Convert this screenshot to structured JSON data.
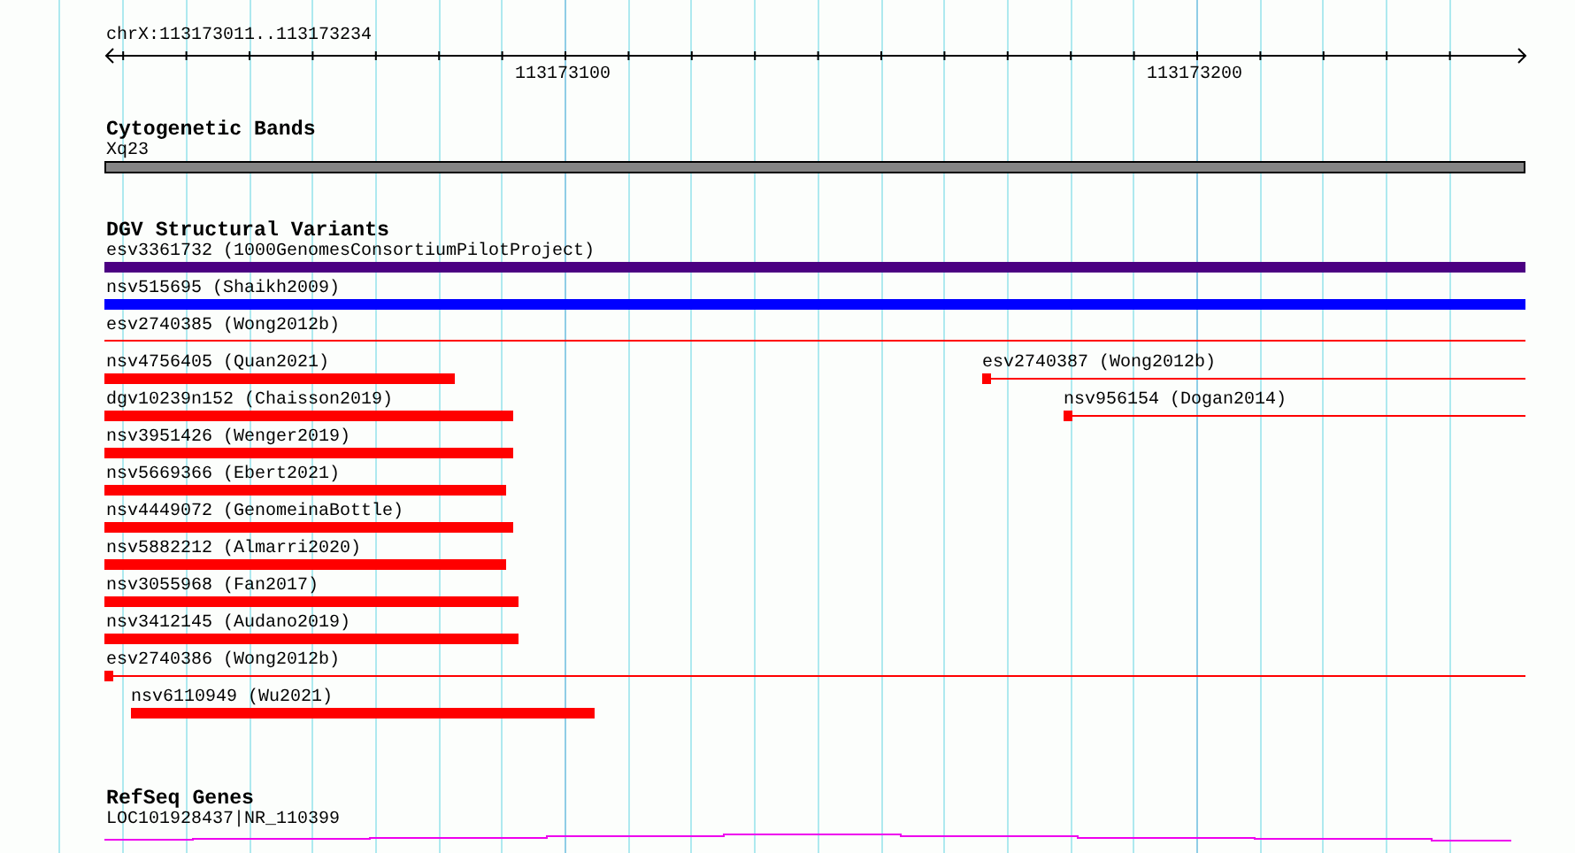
{
  "ruler": {
    "location": "chrX:113173011..113173234",
    "tick_labels": [
      "113173100",
      "113173200"
    ]
  },
  "cytogenetic_bands": {
    "title": "Cytogenetic Bands",
    "band": "Xq23"
  },
  "dgv": {
    "title": "DGV Structural Variants",
    "rows": [
      {
        "variants": [
          {
            "label": "esv3361732 (1000GenomesConsortiumPilotProject)",
            "color": "#4b0082",
            "kind": "bar"
          }
        ]
      },
      {
        "variants": [
          {
            "label": "nsv515695 (Shaikh2009)",
            "color": "#0000ff",
            "kind": "bar"
          }
        ]
      },
      {
        "variants": [
          {
            "label": "esv2740385 (Wong2012b)",
            "color": "#ff0000",
            "kind": "line"
          }
        ]
      },
      {
        "variants": [
          {
            "label": "nsv4756405 (Quan2021)",
            "color": "#ff0000",
            "kind": "bar"
          },
          {
            "label": "esv2740387 (Wong2012b)",
            "color": "#ff0000",
            "kind": "marker-line"
          }
        ]
      },
      {
        "variants": [
          {
            "label": "dgv10239n152 (Chaisson2019)",
            "color": "#ff0000",
            "kind": "bar"
          },
          {
            "label": "nsv956154 (Dogan2014)",
            "color": "#ff0000",
            "kind": "marker-line"
          }
        ]
      },
      {
        "variants": [
          {
            "label": "nsv3951426 (Wenger2019)",
            "color": "#ff0000",
            "kind": "bar"
          }
        ]
      },
      {
        "variants": [
          {
            "label": "nsv5669366 (Ebert2021)",
            "color": "#ff0000",
            "kind": "bar"
          }
        ]
      },
      {
        "variants": [
          {
            "label": "nsv4449072 (GenomeinaBottle)",
            "color": "#ff0000",
            "kind": "bar"
          }
        ]
      },
      {
        "variants": [
          {
            "label": "nsv5882212 (Almarri2020)",
            "color": "#ff0000",
            "kind": "bar"
          }
        ]
      },
      {
        "variants": [
          {
            "label": "nsv3055968 (Fan2017)",
            "color": "#ff0000",
            "kind": "bar"
          }
        ]
      },
      {
        "variants": [
          {
            "label": "nsv3412145 (Audano2019)",
            "color": "#ff0000",
            "kind": "bar"
          }
        ]
      },
      {
        "variants": [
          {
            "label": "esv2740386 (Wong2012b)",
            "color": "#ff0000",
            "kind": "marker-line"
          }
        ]
      },
      {
        "variants": [
          {
            "label": "nsv6110949 (Wu2021)",
            "color": "#ff0000",
            "kind": "bar"
          }
        ]
      }
    ]
  },
  "refseq": {
    "title": "RefSeq Genes",
    "gene": "LOC101928437|NR_110399"
  }
}
